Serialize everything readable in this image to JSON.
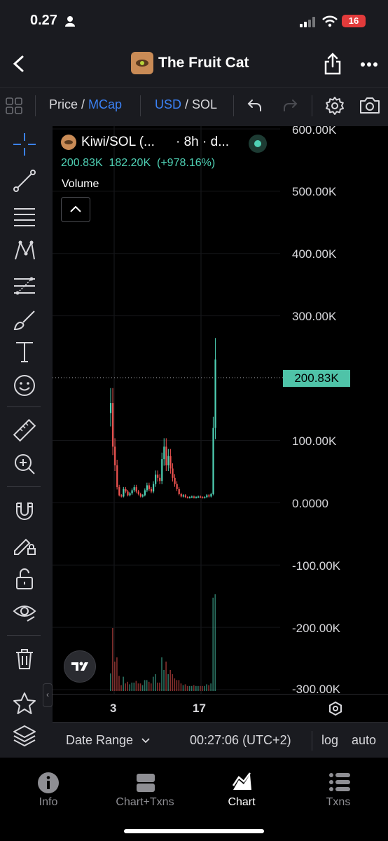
{
  "status_bar": {
    "time": "0.27",
    "battery": "16"
  },
  "nav": {
    "title": "The Fruit Cat"
  },
  "toolbar": {
    "price_label": "Price",
    "slash1": " / ",
    "mcap_label": "MCap",
    "usd_label": "USD",
    "slash2": " / ",
    "sol_label": "SOL"
  },
  "chart_header": {
    "pair": "Kiwi/SOL (...",
    "interval": "· 8h · d...",
    "value1": "200.83K",
    "value2": "182.20K",
    "change": "(+978.16%)",
    "volume_label": "Volume"
  },
  "colors": {
    "accent": "#3b82f6",
    "up": "#4fd1b5",
    "down": "#ef5350",
    "price_tag_bg": "#4fc3a8"
  },
  "price_tag": "200.83K",
  "chart_data": {
    "type": "candlestick",
    "y_ticks": [
      "600.00K",
      "500.00K",
      "400.00K",
      "300.00K",
      "200.83K",
      "100.00K",
      "0.0000",
      "-100.00K",
      "-200.00K",
      "-300.00K"
    ],
    "x_ticks": [
      "3",
      "17"
    ],
    "ylim": [
      -300000,
      600000
    ],
    "current_price": 200830,
    "close_series": [
      160000,
      90000,
      60000,
      25000,
      12000,
      10000,
      22000,
      18000,
      12000,
      15000,
      20000,
      25000,
      18000,
      14000,
      10000,
      12000,
      20000,
      28000,
      22000,
      18000,
      30000,
      45000,
      40000,
      35000,
      70000,
      90000,
      60000,
      75000,
      55000,
      40000,
      30000,
      22000,
      14000,
      10000,
      12000,
      9000,
      8000,
      9000,
      10000,
      8000,
      9000,
      10000,
      9000,
      8000,
      9000,
      12000,
      10000,
      14000,
      120000,
      230000
    ]
  },
  "bottom": {
    "date_range": "Date Range",
    "time": "00:27:06 (UTC+2)",
    "log": "log",
    "auto": "auto"
  },
  "tabs": [
    {
      "label": "Info"
    },
    {
      "label": "Chart+Txns"
    },
    {
      "label": "Chart"
    },
    {
      "label": "Txns"
    }
  ]
}
